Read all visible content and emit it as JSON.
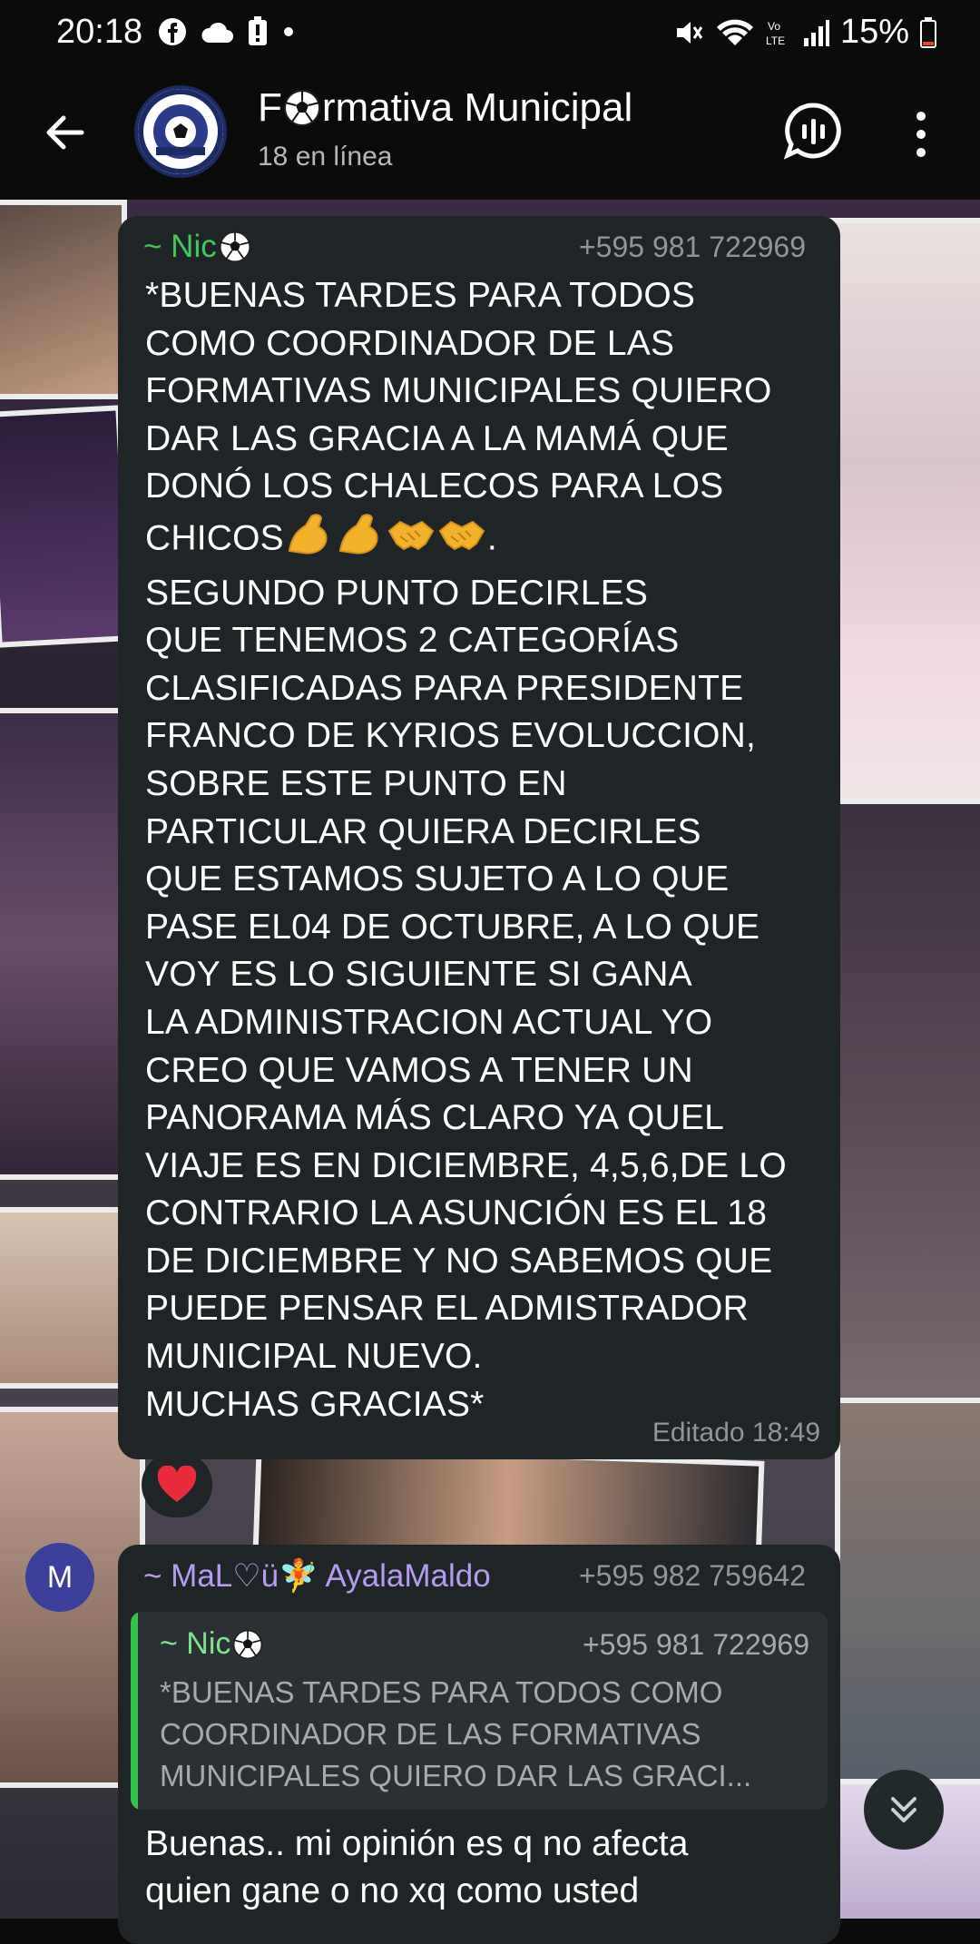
{
  "status_bar": {
    "time": "20:18",
    "battery": "15%",
    "icons": [
      "facebook-icon",
      "cloud-icon",
      "alert-battery-icon",
      "dot-icon",
      "mute-icon",
      "wifi-icon",
      "volte-icon",
      "signal-icon",
      "battery-icon"
    ]
  },
  "header": {
    "title_prefix": "F",
    "title_suffix": "rmativa Municipal",
    "subtitle": "18 en línea"
  },
  "messages": [
    {
      "sender": "~ Nic",
      "phone": "+595 981 722969",
      "text_part1": "*BUENAS TARDES PARA TODOS\nCOMO COORDINADOR DE LAS\nFORMATIVAS MUNICIPALES QUIERO\nDAR LAS GRACIA  A LA MAMÁ QUE\nDONÓ LOS CHALECOS PARA LOS\nCHICOS",
      "text_part2": ".\nSEGUNDO PUNTO DECIRLES\nQUE TENEMOS 2 CATEGORÍAS\nCLASIFICADAS PARA PRESIDENTE\nFRANCO DE KYRIOS EVOLUCCION,\nSOBRE ESTE PUNTO EN\nPARTICULAR QUIERA DECIRLES\nQUE ESTAMOS SUJETO A LO QUE\nPASE EL04 DE OCTUBRE, A LO QUE\nVOY ES LO SIGUIENTE SI GANA\nLA ADMINISTRACION ACTUAL YO\nCREO QUE VAMOS A TENER UN\nPANORAMA MÁS CLARO YA QUEL\nVIAJE ES EN DICIEMBRE, 4,5,6,DE LO\nCONTRARIO LA ASUNCIÓN ES EL 18\nDE DICIEMBRE Y NO SABEMOS QUE\nPUEDE PENSAR EL ADMISTRADOR\nMUNICIPAL NUEVO.\nMUCHAS GRACIAS*",
      "edited_label": "Editado 18:49",
      "reaction": "❤️"
    },
    {
      "avatar_letter": "M",
      "sender": "~ MaL♡ü🧚 AyalaMaldo",
      "phone": "+595 982 759642",
      "quote": {
        "sender": "~ Nic",
        "phone": "+595 981 722969",
        "text": "*BUENAS TARDES PARA TODOS COMO\nCOORDINADOR DE LAS FORMATIVAS\nMUNICIPALES QUIERO DAR LAS GRACI..."
      },
      "text": "Buenas.. mi opinión es q no afecta\nquien gane o no xq como usted"
    }
  ],
  "colors": {
    "bubble": "#1f2426",
    "sender_green": "#42c95c",
    "sender_purple": "#b59cf0",
    "quote_bar": "#33c24d"
  }
}
